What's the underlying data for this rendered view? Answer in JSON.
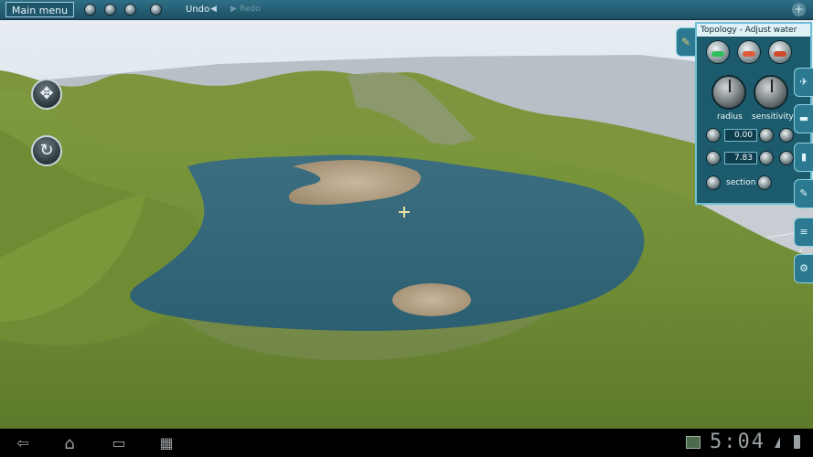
{
  "toolbar": {
    "main_menu_label": "Main menu",
    "undo_label": "Undo",
    "redo_label": "Redo"
  },
  "panel": {
    "title": "Topology - Adjust water",
    "radius_label": "radius",
    "sensitivity_label": "sensitivity",
    "value_1": "0.00",
    "value_2": "7.83",
    "section_label": "section"
  },
  "system": {
    "clock": "5:04"
  },
  "icons": {
    "move": "✥",
    "rotate": "↻",
    "back": "⇦",
    "home": "⌂",
    "recent": "▭",
    "apps": "▦",
    "plus": "+"
  }
}
